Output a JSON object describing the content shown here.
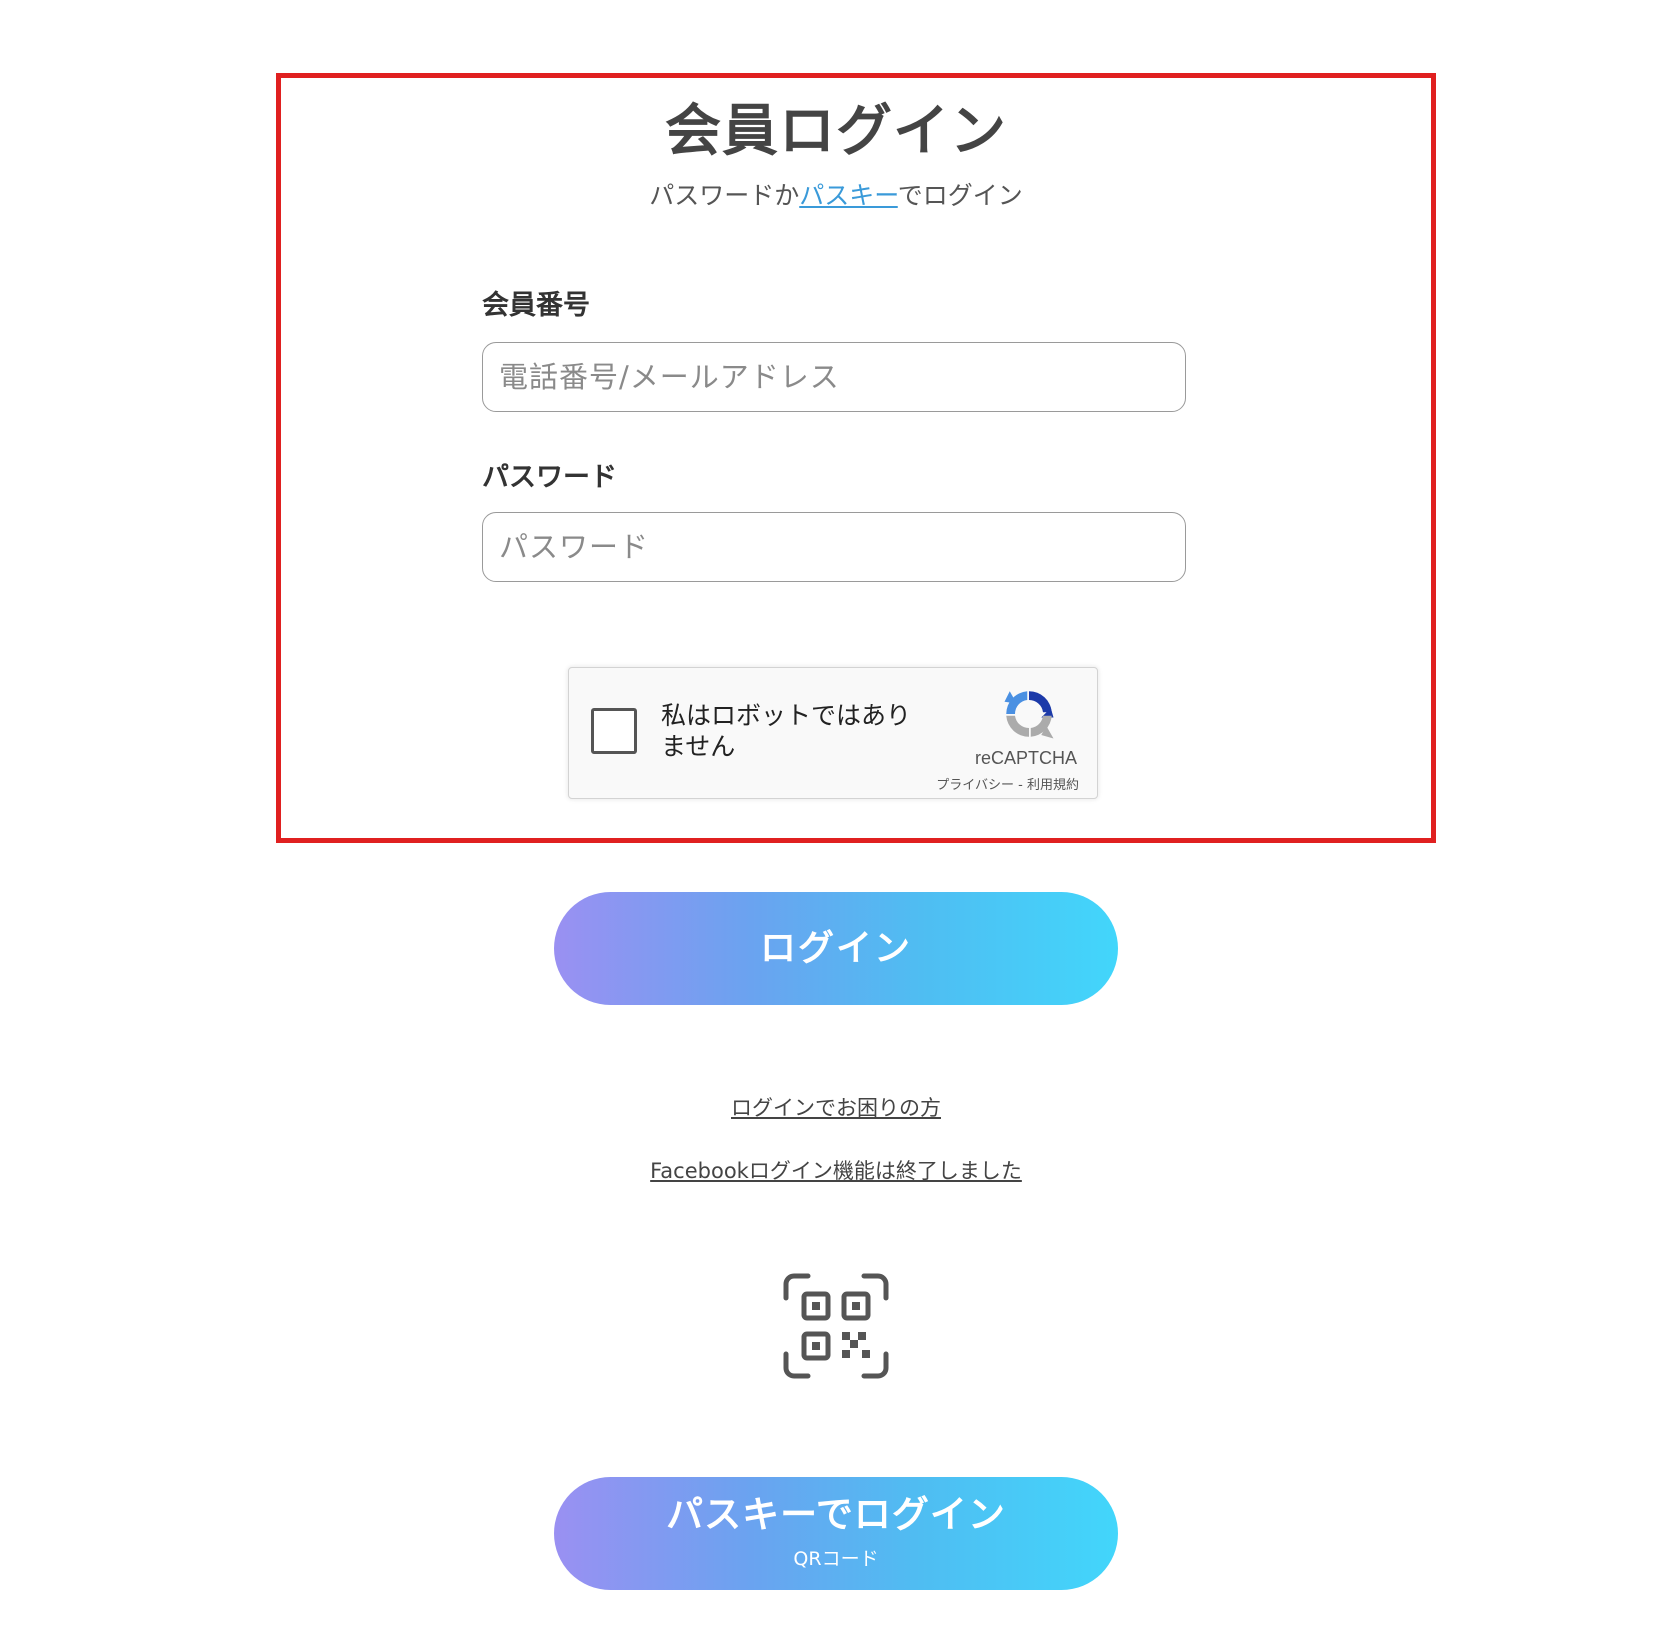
{
  "header": {
    "title": "会員ログイン",
    "subtitle_prefix": "パスワードか",
    "subtitle_link": "パスキー",
    "subtitle_suffix": "でログイン"
  },
  "form": {
    "member_id": {
      "label": "会員番号",
      "placeholder": "電話番号/メールアドレス",
      "value": ""
    },
    "password": {
      "label": "パスワード",
      "placeholder": "パスワード",
      "value": ""
    }
  },
  "recaptcha": {
    "checkbox_label": "私はロボットではありません",
    "brand": "reCAPTCHA",
    "privacy": "プライバシー",
    "separator": " - ",
    "terms": "利用規約"
  },
  "buttons": {
    "login": "ログイン",
    "passkey_login": "パスキーでログイン",
    "passkey_sub": "QRコード"
  },
  "links": {
    "trouble": "ログインでお困りの方",
    "facebook": "Facebookログイン機能は終了しました"
  },
  "icons": {
    "qr": "qr-code-scan-icon",
    "recaptcha": "recaptcha-logo-icon"
  },
  "colors": {
    "highlight": "#e02020",
    "link": "#3a9ad9",
    "gradient_start": "#9a90f2",
    "gradient_end": "#42d6fb"
  }
}
